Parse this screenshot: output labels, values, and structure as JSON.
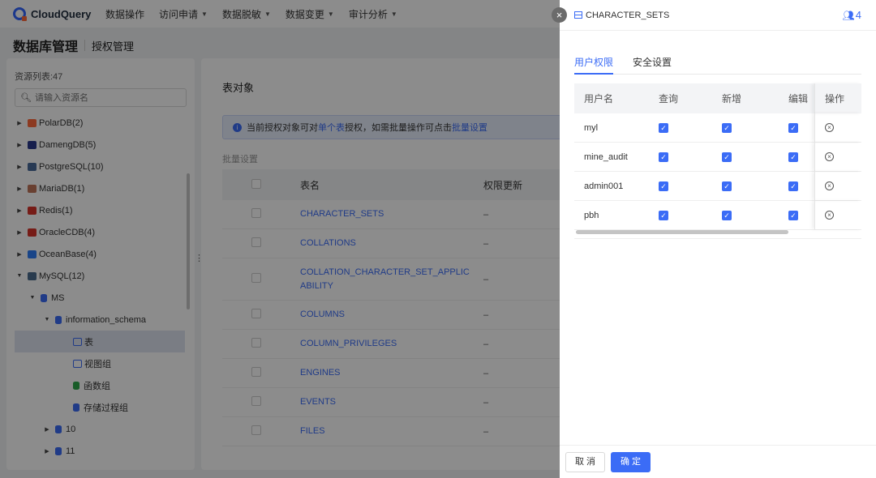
{
  "app": {
    "logo": "CloudQuery"
  },
  "nav": [
    {
      "label": "数据操作",
      "dropdown": false
    },
    {
      "label": "访问申请",
      "dropdown": true
    },
    {
      "label": "数据脱敏",
      "dropdown": true
    },
    {
      "label": "数据变更",
      "dropdown": true
    },
    {
      "label": "审计分析",
      "dropdown": true
    }
  ],
  "page": {
    "title": "数据库管理",
    "subtitle": "授权管理"
  },
  "left": {
    "count_label": "资源列表:47",
    "search_placeholder": "请输入资源名",
    "tree": [
      {
        "label": "PolarDB(2)",
        "icon": "polardb-icon",
        "color": "#ff6a3d"
      },
      {
        "label": "DamengDB(5)",
        "icon": "dameng-icon",
        "color": "#2b3a8c"
      },
      {
        "label": "PostgreSQL(10)",
        "icon": "postgresql-icon",
        "color": "#4a6b9a"
      },
      {
        "label": "MariaDB(1)",
        "icon": "mariadb-icon",
        "color": "#c0765a"
      },
      {
        "label": "Redis(1)",
        "icon": "redis-icon",
        "color": "#d8332a"
      },
      {
        "label": "OracleCDB(4)",
        "icon": "oracle-icon",
        "color": "#d8332a"
      },
      {
        "label": "OceanBase(4)",
        "icon": "oceanbase-icon",
        "color": "#2e7ef7"
      },
      {
        "label": "MySQL(12)",
        "icon": "mysql-icon",
        "color": "#4b6c8f"
      }
    ],
    "tree_ms": "MS",
    "tree_schema": "information_schema",
    "tree_children": [
      {
        "label": "表",
        "icon": "table-icon"
      },
      {
        "label": "视图组",
        "icon": "view-icon"
      },
      {
        "label": "函数组",
        "icon": "function-icon"
      },
      {
        "label": "存储过程组",
        "icon": "procedure-icon"
      }
    ],
    "tree_more": [
      "10",
      "11"
    ]
  },
  "main": {
    "title": "表对象",
    "notice_prefix": "当前授权对象可对",
    "notice_link1": "单个表",
    "notice_mid": "授权，如需批量操作可点击",
    "notice_link2": "批量设置",
    "batch_label": "批量设置",
    "columns": [
      "表名",
      "权限更新"
    ],
    "rows": [
      {
        "name": "CHARACTER_SETS",
        "update": "–"
      },
      {
        "name": "COLLATIONS",
        "update": "–"
      },
      {
        "name": "COLLATION_CHARACTER_SET_APPLICABILITY",
        "name_line1": "COLLATION_CHARACTER_SET_APPLIC",
        "name_line2": "ABILITY",
        "update": "–"
      },
      {
        "name": "COLUMNS",
        "update": "–"
      },
      {
        "name": "COLUMN_PRIVILEGES",
        "update": "–"
      },
      {
        "name": "ENGINES",
        "update": "–"
      },
      {
        "name": "EVENTS",
        "update": "–"
      },
      {
        "name": "FILES",
        "update": "–"
      }
    ]
  },
  "drawer": {
    "close_symbol": "×",
    "title": "CHARACTER_SETS",
    "user_count": "4",
    "tabs": [
      {
        "label": "用户权限",
        "active": true
      },
      {
        "label": "安全设置",
        "active": false
      }
    ],
    "perm_columns": [
      "用户名",
      "查询",
      "新增",
      "编辑",
      "操作"
    ],
    "perm_rows": [
      {
        "user": "myl",
        "query": true,
        "add": true,
        "edit": true
      },
      {
        "user": "mine_audit",
        "query": true,
        "add": true,
        "edit": true
      },
      {
        "user": "admin001",
        "query": true,
        "add": true,
        "edit": true
      },
      {
        "user": "pbh",
        "query": true,
        "add": true,
        "edit": true
      }
    ],
    "cancel_label": "取 消",
    "ok_label": "确 定"
  },
  "colors": {
    "accent": "#3b6cf6",
    "overlay": "rgba(0,0,0,0.45)"
  }
}
